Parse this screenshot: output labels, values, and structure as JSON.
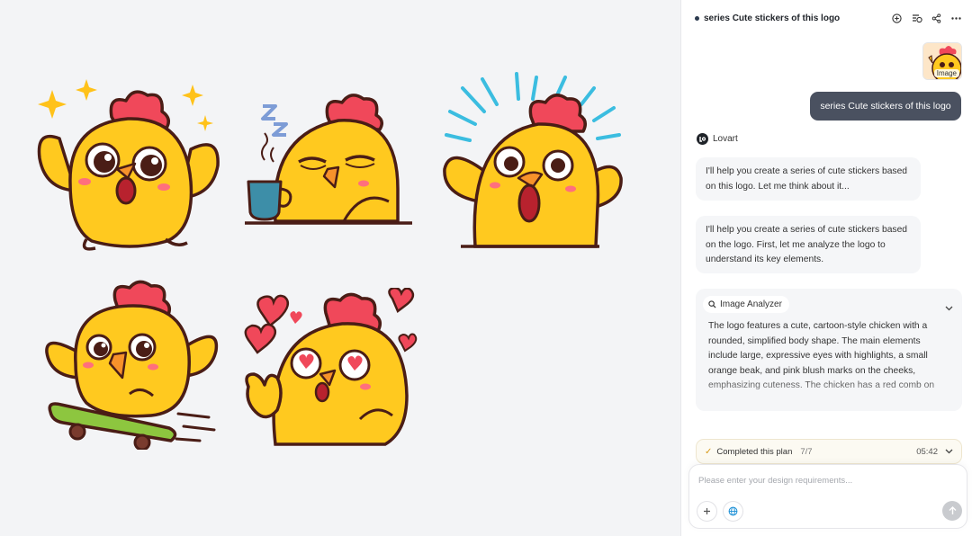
{
  "header": {
    "title": "series Cute stickers of this logo",
    "icons": [
      "add-circle-icon",
      "history-icon",
      "share-icon",
      "more-icon"
    ]
  },
  "attachment": {
    "label": "Image"
  },
  "user_message": "series Cute stickers of this logo",
  "agent": {
    "name": "Lovart"
  },
  "messages": [
    "I'll help you create a series of cute stickers based on this logo. Let me think about it...",
    "I'll help you create a series of cute stickers based on the logo. First, let me analyze the logo to understand its key elements."
  ],
  "tool": {
    "name": "Image Analyzer",
    "text": "The logo features a cute, cartoon-style chicken with a rounded, simplified body shape. The main elements include large, expressive eyes with highlights, a small orange beak, and pink blush marks on the cheeks, emphasizing cuteness. The chicken has a red comb on"
  },
  "plan": {
    "label": "Completed this plan",
    "count": "7/7",
    "time": "05:42"
  },
  "composer": {
    "placeholder": "Please enter your design requirements..."
  },
  "colors": {
    "chick_yellow": "#ffc91f",
    "comb_red": "#f0485a",
    "outline": "#4a1d16",
    "bubble": "#4a5160"
  }
}
